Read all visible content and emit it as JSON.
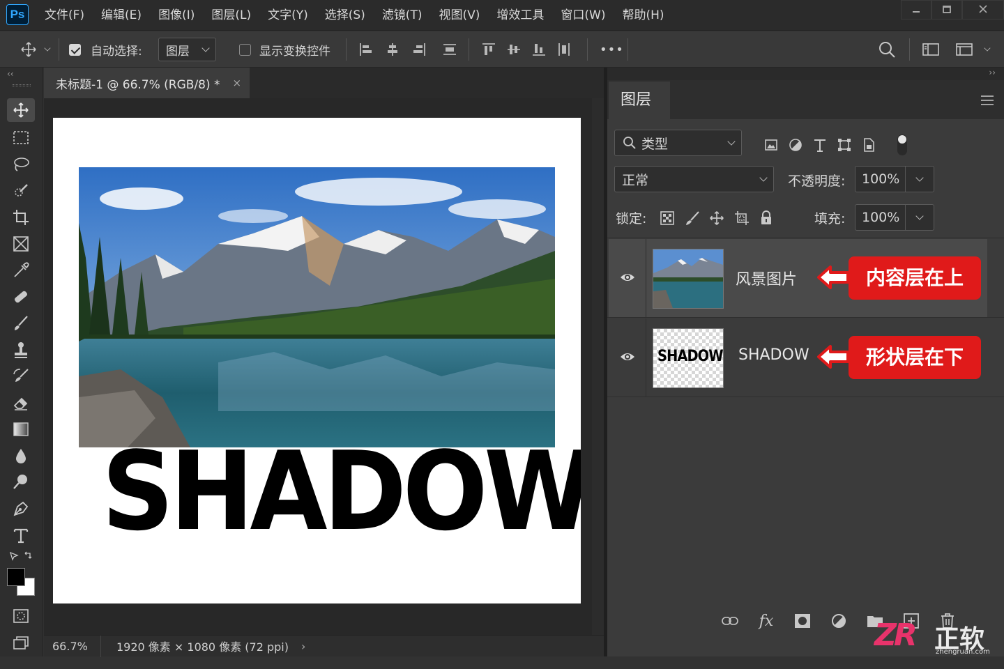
{
  "app": {
    "logo": "Ps",
    "menu": [
      "文件(F)",
      "编辑(E)",
      "图像(I)",
      "图层(L)",
      "文字(Y)",
      "选择(S)",
      "滤镜(T)",
      "视图(V)",
      "增效工具",
      "窗口(W)",
      "帮助(H)"
    ],
    "window_controls": [
      "minimize-icon",
      "restore-icon",
      "close-icon"
    ]
  },
  "options": {
    "auto_select_label": "自动选择:",
    "auto_select_checked": true,
    "auto_select_target": "图层",
    "show_transform_label": "显示变换控件",
    "show_transform_checked": false,
    "more_label": "•••"
  },
  "doc": {
    "tab_title": "未标题-1 @ 66.7% (RGB/8) *",
    "close_glyph": "×",
    "canvas_text": "SHADOW",
    "zoom": "66.7%",
    "info": "1920 像素 × 1080 像素 (72 ppi)",
    "info_arrow": "›"
  },
  "toolbar": {
    "collapse": "‹‹",
    "tools": [
      "move-tool",
      "marquee-tool",
      "lasso-tool",
      "quick-select-tool",
      "crop-tool",
      "frame-tool",
      "eyedropper-tool",
      "healing-tool",
      "brush-tool",
      "stamp-tool",
      "history-brush-tool",
      "eraser-tool",
      "gradient-tool",
      "blur-tool",
      "dodge-tool",
      "pen-tool",
      "type-tool",
      "path-select-tool",
      "hand-tool"
    ],
    "fg_color": "#000000",
    "bg_color": "#ffffff"
  },
  "layers_panel": {
    "expand": "››",
    "tab": "图层",
    "filter_label": "类型",
    "blend_mode": "正常",
    "opacity_label": "不透明度:",
    "opacity_value": "100%",
    "lock_label": "锁定:",
    "fill_label": "填充:",
    "fill_value": "100%",
    "layers": [
      {
        "name": "风景图片",
        "visible": true,
        "selected": true,
        "annotation": "内容层在上"
      },
      {
        "name": "SHADOW",
        "visible": true,
        "selected": false,
        "thumb_text": "SHADOW",
        "annotation": "形状层在下"
      }
    ]
  },
  "watermark": {
    "logo": "ZR",
    "brand": "正软",
    "site": "zhengruan.com"
  },
  "colors": {
    "accent_red": "#e01a1a",
    "ps_blue": "#31a8ff"
  }
}
